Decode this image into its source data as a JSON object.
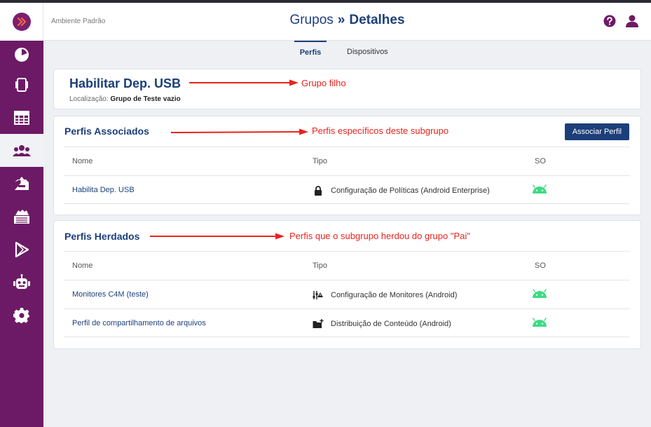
{
  "header": {
    "environment": "Ambiente Padrão",
    "breadcrumb_parent": "Grupos",
    "breadcrumb_separator": "»",
    "breadcrumb_current": "Detalhes"
  },
  "tabs": [
    {
      "label": "Perfis",
      "active": true
    },
    {
      "label": "Dispositivos",
      "active": false
    }
  ],
  "group": {
    "title": "Habilitar Dep. USB",
    "location_label": "Localização:",
    "location_value": "Grupo de Teste vazio"
  },
  "associated": {
    "title": "Perfis Associados",
    "button_label": "Associar Perfil",
    "columns": [
      "Nome",
      "Tipo",
      "SO"
    ],
    "rows": [
      {
        "name": "Habilita Dep. USB",
        "type": "Configuração de Políticas (Android Enterprise)",
        "type_icon": "lock-icon",
        "os_icon": "android-icon"
      }
    ]
  },
  "inherited": {
    "title": "Perfis Herdados",
    "columns": [
      "Nome",
      "Tipo",
      "SO"
    ],
    "rows": [
      {
        "name": "Monitores C4M (teste)",
        "type": "Configuração de Monitores (Android)",
        "type_icon": "monitor-config-icon",
        "os_icon": "android-icon"
      },
      {
        "name": "Perfil de compartilhamento de arquivos",
        "type": "Distribuição de Conteúdo (Android)",
        "type_icon": "content-distribution-icon",
        "os_icon": "android-icon"
      }
    ]
  },
  "annotations": {
    "group_child": "Grupo filho",
    "specific_profiles": "Perfis específicos deste subgrupo",
    "inherited_profiles": "Perfis que o subgrupo herdou do grupo \"Pai\""
  },
  "sidebar": {
    "items": [
      {
        "icon": "dashboard-icon",
        "active": false
      },
      {
        "icon": "devices-icon",
        "active": false
      },
      {
        "icon": "table-icon",
        "active": false
      },
      {
        "icon": "groups-icon",
        "active": true
      },
      {
        "icon": "inbox-icon",
        "active": false
      },
      {
        "icon": "apps-icon",
        "active": false
      },
      {
        "icon": "play-store-icon",
        "active": false
      },
      {
        "icon": "robot-icon",
        "active": false
      },
      {
        "icon": "settings-icon",
        "active": false
      }
    ]
  },
  "colors": {
    "sidebar": "#6d1a66",
    "primary": "#1c3f7a",
    "android": "#3ddc84",
    "annotation": "#e8231d"
  }
}
